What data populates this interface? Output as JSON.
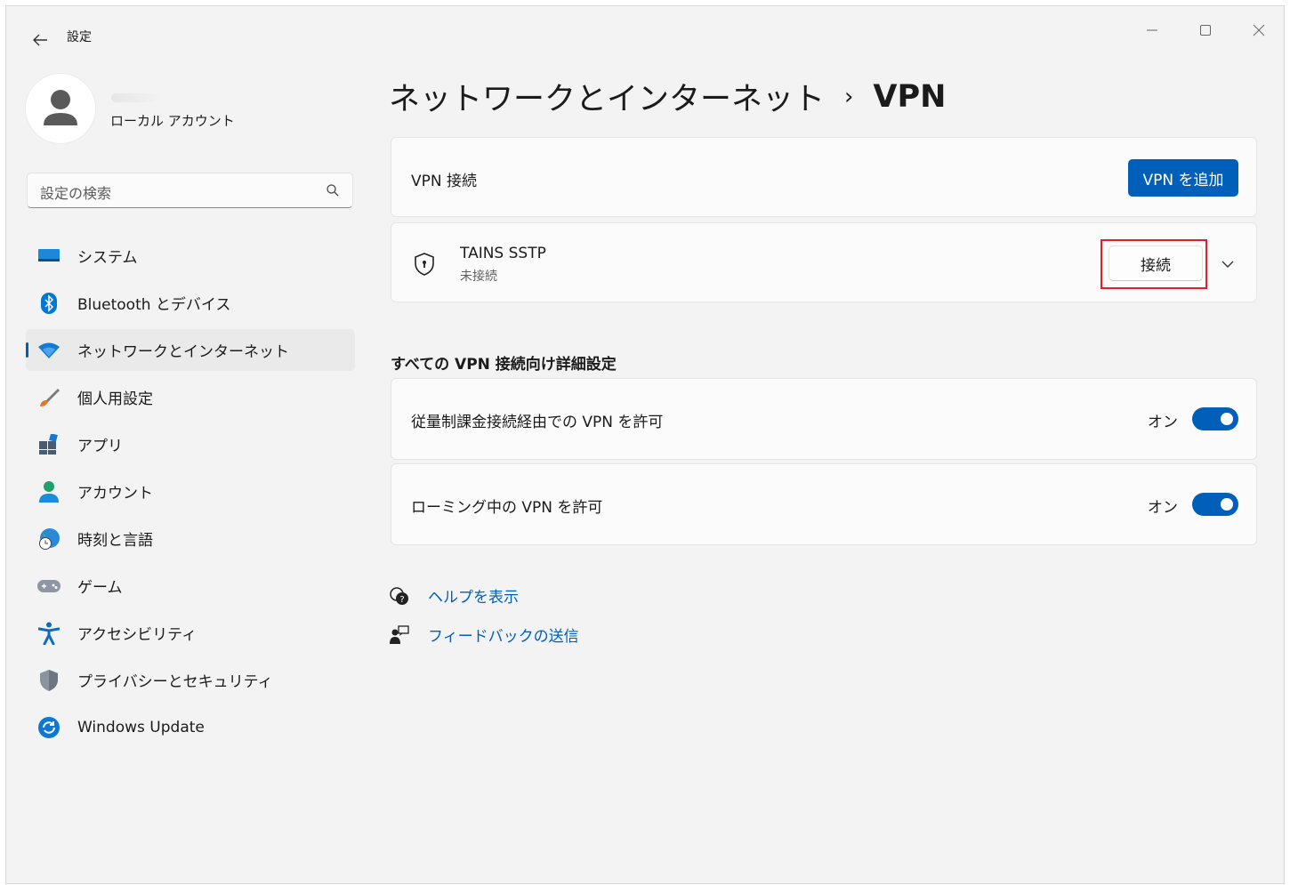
{
  "app": {
    "title": "設定"
  },
  "account": {
    "type": "ローカル アカウント"
  },
  "search": {
    "placeholder": "設定の検索"
  },
  "sidebar": {
    "items": [
      {
        "label": "システム",
        "icon": "system-icon"
      },
      {
        "label": "Bluetooth とデバイス",
        "icon": "bluetooth-icon"
      },
      {
        "label": "ネットワークとインターネット",
        "icon": "wifi-icon",
        "active": true
      },
      {
        "label": "個人用設定",
        "icon": "brush-icon"
      },
      {
        "label": "アプリ",
        "icon": "apps-icon"
      },
      {
        "label": "アカウント",
        "icon": "person-icon"
      },
      {
        "label": "時刻と言語",
        "icon": "globe-clock-icon"
      },
      {
        "label": "ゲーム",
        "icon": "gamepad-icon"
      },
      {
        "label": "アクセシビリティ",
        "icon": "accessibility-icon"
      },
      {
        "label": "プライバシーとセキュリティ",
        "icon": "shield-icon"
      },
      {
        "label": "Windows Update",
        "icon": "update-icon"
      }
    ]
  },
  "breadcrumb": {
    "parent": "ネットワークとインターネット",
    "separator": "›",
    "current": "VPN"
  },
  "vpn": {
    "header_label": "VPN 接続",
    "add_button": "VPN を追加",
    "connection": {
      "name": "TAINS SSTP",
      "status": "未接続",
      "connect_button": "接続"
    }
  },
  "advanced": {
    "title": "すべての VPN 接続向け詳細設定",
    "settings": [
      {
        "label": "従量制課金接続経由での VPN を許可",
        "state": "オン",
        "on": true
      },
      {
        "label": "ローミング中の VPN を許可",
        "state": "オン",
        "on": true
      }
    ]
  },
  "links": {
    "help": "ヘルプを表示",
    "feedback": "フィードバックの送信"
  },
  "colors": {
    "accent": "#005fb8",
    "highlight": "#e31e24",
    "background": "#f3f3f3"
  }
}
